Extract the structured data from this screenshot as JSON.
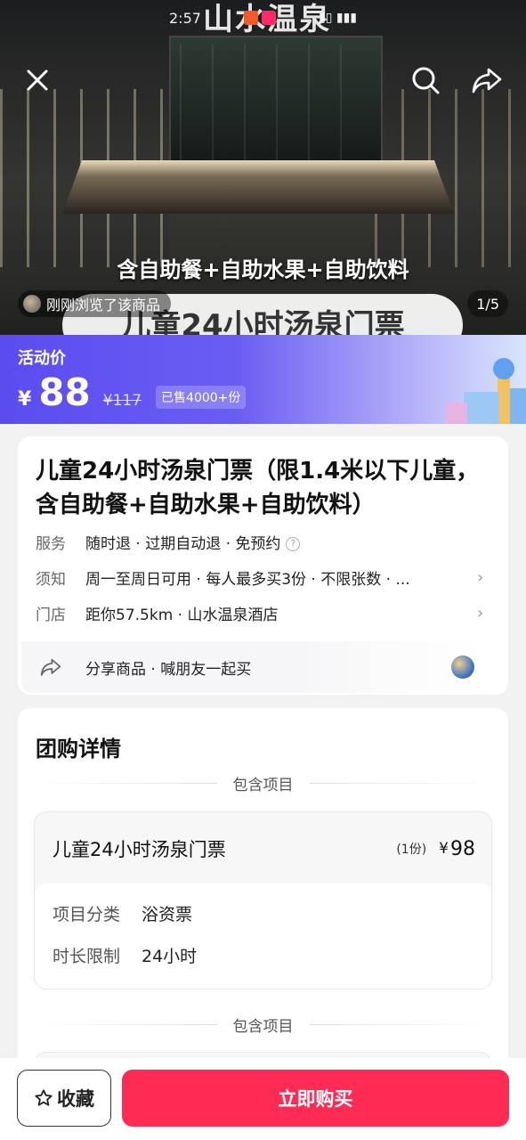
{
  "status_bar": {
    "time": "2:57"
  },
  "hero": {
    "sign_text": "山水温泉",
    "overlay_line1": "含自助餐+自助水果+自助饮料",
    "overlay_line2": "儿童24小时汤泉门票",
    "viewed_text": "刚刚浏览了该商品",
    "page_indicator": "1/5"
  },
  "promo": {
    "label": "活动价",
    "currency": "¥",
    "price": "88",
    "original_price": "¥117",
    "sold": "已售4000+份",
    "gradient_start": "#5b4cf0",
    "gradient_end": "#d8e6fb"
  },
  "product": {
    "title": "儿童24小时汤泉门票（限1.4米以下儿童，含自助餐+自助水果+自助饮料）",
    "rows": [
      {
        "key": "服务",
        "value": "随时退 · 过期自动退 · 免预约"
      },
      {
        "key": "须知",
        "value": "周一至周日可用 · 每人最多买3份 · 不限张数 · ..."
      },
      {
        "key": "门店",
        "value": "距你57.5km · 山水温泉酒店"
      }
    ],
    "share_text": "分享商品 · 喊朋友一起买"
  },
  "details": {
    "section_title": "团购详情",
    "divider_label": "包含项目",
    "item": {
      "name": "儿童24小时汤泉门票",
      "qty": "(1份)",
      "currency": "¥",
      "price": "98",
      "attributes": [
        {
          "key": "项目分类",
          "value": "浴资票"
        },
        {
          "key": "时长限制",
          "value": "24小时"
        }
      ]
    },
    "divider_label_2": "包含项目"
  },
  "bottom_bar": {
    "favorite_label": "收藏",
    "buy_label": "立即购买",
    "buy_color": "#fe2c55"
  },
  "icons": [
    "close-icon",
    "search-icon",
    "share-icon",
    "help-icon",
    "chevron-right-icon",
    "star-icon"
  ]
}
